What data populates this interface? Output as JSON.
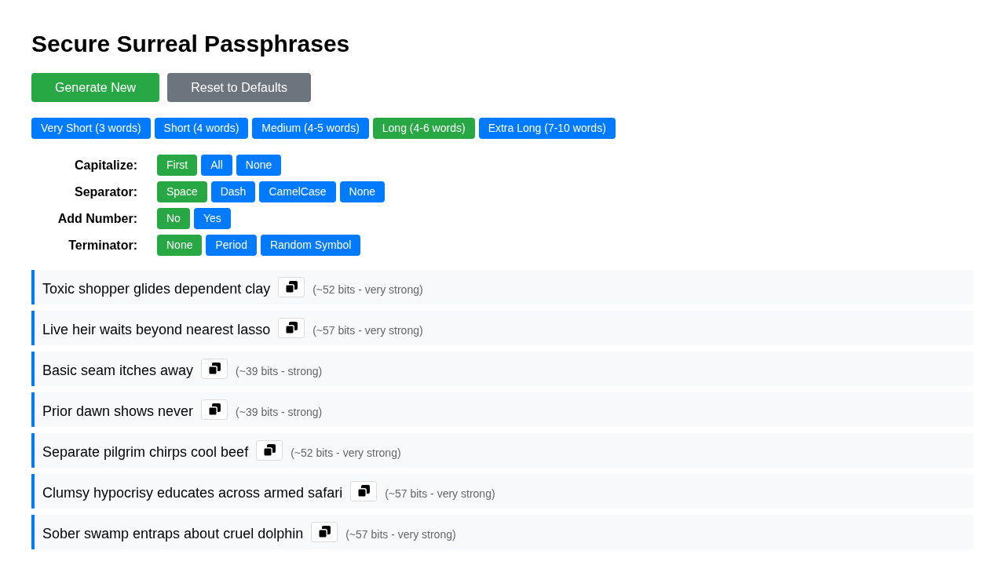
{
  "title": "Secure Surreal Passphrases",
  "actions": [
    {
      "label": "Generate New",
      "kind": "generate"
    },
    {
      "label": "Reset to Defaults",
      "kind": "reset"
    }
  ],
  "lengths": [
    {
      "label": "Very Short (3 words)",
      "selected": false
    },
    {
      "label": "Short (4 words)",
      "selected": false
    },
    {
      "label": "Medium (4-5 words)",
      "selected": false
    },
    {
      "label": "Long (4-6 words)",
      "selected": true
    },
    {
      "label": "Extra Long (7-10 words)",
      "selected": false
    }
  ],
  "options": [
    {
      "label": "Capitalize:",
      "choices": [
        {
          "label": "First",
          "selected": true
        },
        {
          "label": "All",
          "selected": false
        },
        {
          "label": "None",
          "selected": false
        }
      ]
    },
    {
      "label": "Separator:",
      "choices": [
        {
          "label": "Space",
          "selected": true
        },
        {
          "label": "Dash",
          "selected": false
        },
        {
          "label": "CamelCase",
          "selected": false
        },
        {
          "label": "None",
          "selected": false
        }
      ]
    },
    {
      "label": "Add Number:",
      "choices": [
        {
          "label": "No",
          "selected": true
        },
        {
          "label": "Yes",
          "selected": false
        }
      ]
    },
    {
      "label": "Terminator:",
      "choices": [
        {
          "label": "None",
          "selected": true
        },
        {
          "label": "Period",
          "selected": false
        },
        {
          "label": "Random Symbol",
          "selected": false
        }
      ]
    }
  ],
  "passphrases": [
    {
      "text": "Toxic shopper glides dependent clay",
      "strength": "(~52 bits - very strong)"
    },
    {
      "text": "Live heir waits beyond nearest lasso",
      "strength": "(~57 bits - very strong)"
    },
    {
      "text": "Basic seam itches away",
      "strength": "(~39 bits - strong)"
    },
    {
      "text": "Prior dawn shows never",
      "strength": "(~39 bits - strong)"
    },
    {
      "text": "Separate pilgrim chirps cool beef",
      "strength": "(~52 bits - very strong)"
    },
    {
      "text": "Clumsy hypocrisy educates across armed safari",
      "strength": "(~57 bits - very strong)"
    },
    {
      "text": "Sober swamp entraps about cruel dolphin",
      "strength": "(~57 bits - very strong)"
    }
  ]
}
